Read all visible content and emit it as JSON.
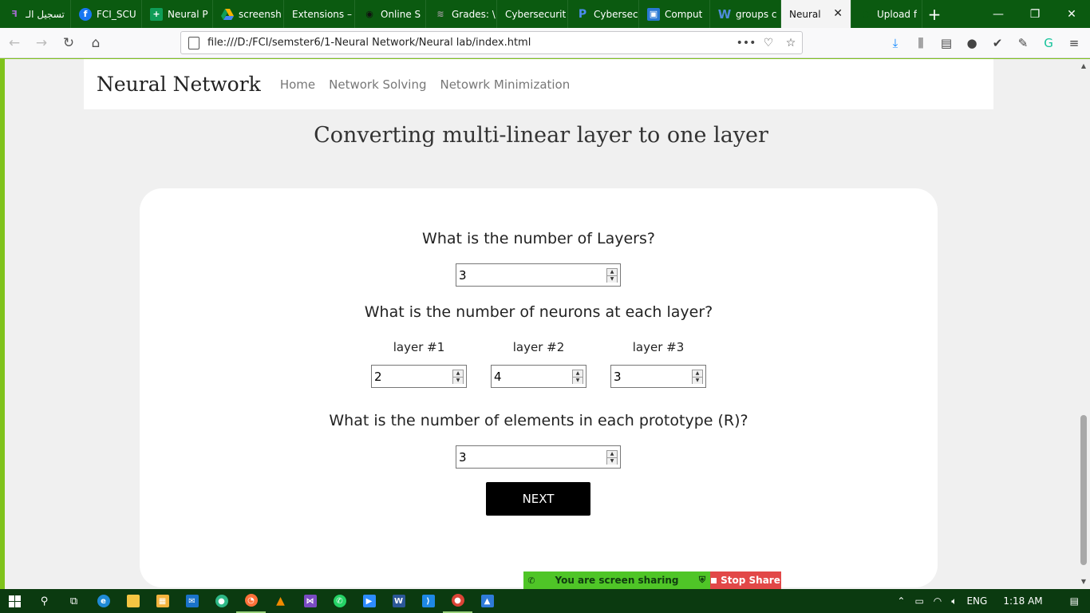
{
  "browser": {
    "tabs": [
      {
        "label": "تسجيل الـ",
        "icon": "slack-like-icon",
        "color": "#a56cd0"
      },
      {
        "label": "FCI_SCU",
        "icon": "facebook-icon",
        "color": "#1877f2"
      },
      {
        "label": "Neural P",
        "icon": "classroom-icon",
        "color": "#0f9d58"
      },
      {
        "label": "screensh",
        "icon": "drive-icon",
        "color": "#f4b400"
      },
      {
        "label": "Extensions –",
        "icon": "",
        "color": ""
      },
      {
        "label": "Online S",
        "icon": "eye-icon",
        "color": "#222"
      },
      {
        "label": "Grades: \\",
        "icon": "moodle-icon",
        "color": "#888"
      },
      {
        "label": "Cybersecurit",
        "icon": "",
        "color": ""
      },
      {
        "label": "Cybersec",
        "icon": "p-icon",
        "color": "#1f64c8"
      },
      {
        "label": "Comput",
        "icon": "profile-icon",
        "color": "#2a79d4"
      },
      {
        "label": "groups c",
        "icon": "word-w-icon",
        "color": "#2b5797"
      },
      {
        "label": "Neural",
        "icon": "",
        "color": "",
        "active": true
      },
      {
        "label": "Upload f",
        "icon": "upload-icon",
        "color": "#0b5a10"
      }
    ],
    "new_tab": "+",
    "minimize": "—",
    "restore": "❐",
    "close": "✕",
    "url": "file:///D:/FCI/semster6/1-Neural Network/Neural lab/index.html",
    "url_more": "•••"
  },
  "site": {
    "brand": "Neural Network",
    "nav": [
      "Home",
      "Network Solving",
      "Netowrk Minimization"
    ],
    "heading": "Converting multi-linear layer to one layer"
  },
  "form": {
    "q_layers": "What is the number of Layers?",
    "layers_value": "3",
    "q_neurons": "What is the number of neurons at each layer?",
    "layers": [
      {
        "label": "layer #1",
        "value": "2"
      },
      {
        "label": "layer #2",
        "value": "4"
      },
      {
        "label": "layer #3",
        "value": "3"
      }
    ],
    "q_elements": "What is the number of elements in each prototype (R)?",
    "elements_value": "3",
    "next_label": "NEXT"
  },
  "share": {
    "text": "You are screen sharing",
    "stop": "Stop Share"
  },
  "taskbar": {
    "lang": "ENG",
    "time": "1:18 AM"
  }
}
